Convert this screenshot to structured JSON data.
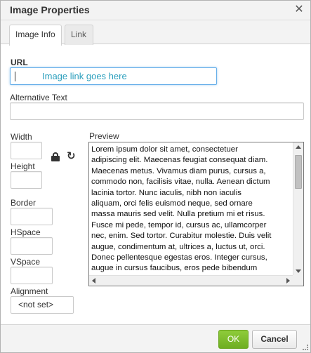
{
  "dialog": {
    "title": "Image Properties",
    "close_glyph": "✕"
  },
  "tabs": [
    {
      "label": "Image Info",
      "active": true
    },
    {
      "label": "Link",
      "active": false
    }
  ],
  "fields": {
    "url": {
      "label": "URL",
      "value": "Image link goes here"
    },
    "alt": {
      "label": "Alternative Text",
      "value": ""
    },
    "width": {
      "label": "Width",
      "value": ""
    },
    "height": {
      "label": "Height",
      "value": ""
    },
    "border": {
      "label": "Border",
      "value": ""
    },
    "hspace": {
      "label": "HSpace",
      "value": ""
    },
    "vspace": {
      "label": "VSpace",
      "value": ""
    },
    "alignment": {
      "label": "Alignment",
      "selected": "<not set>"
    }
  },
  "preview": {
    "label": "Preview",
    "text": "Lorem ipsum dolor sit amet, consectetuer\nadipiscing elit. Maecenas feugiat consequat diam.\nMaecenas metus. Vivamus diam purus, cursus a,\ncommodo non, facilisis vitae, nulla. Aenean dictum\nlacinia tortor. Nunc iaculis, nibh non iaculis\naliquam, orci felis euismod neque, sed ornare\nmassa mauris sed velit. Nulla pretium mi et risus.\nFusce mi pede, tempor id, cursus ac, ullamcorper\nnec, enim. Sed tortor. Curabitur molestie. Duis velit\naugue, condimentum at, ultrices a, luctus ut, orci.\nDonec pellentesque egestas eros. Integer cursus,\naugue in cursus faucibus, eros pede bibendum"
  },
  "icons": {
    "lock": "lock-icon",
    "reset": "reload-icon",
    "reset_glyph": "↻"
  },
  "buttons": {
    "ok": "OK",
    "cancel": "Cancel"
  },
  "colors": {
    "ok_green": "#7cbd2a",
    "focus_blue": "#66afe9",
    "placeholder_teal": "#2b9fbd"
  }
}
